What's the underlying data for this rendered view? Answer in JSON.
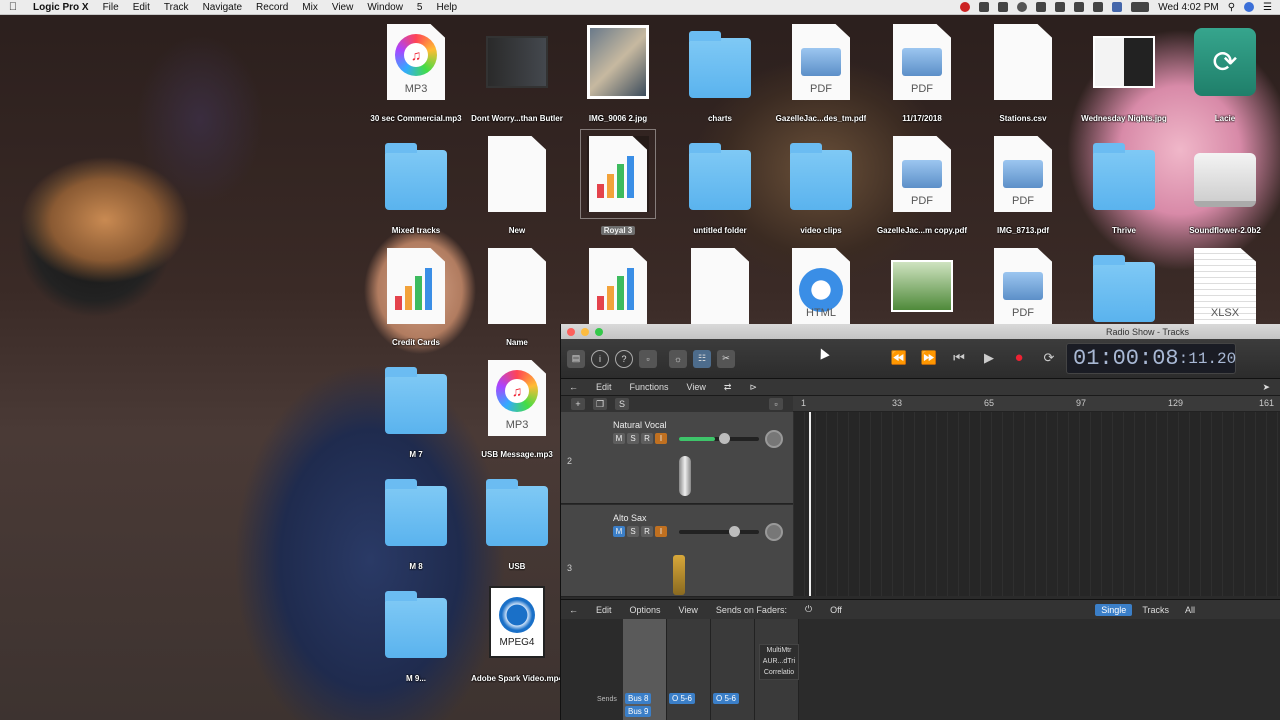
{
  "menubar": {
    "app": "Logic Pro X",
    "items": [
      "File",
      "Edit",
      "Track",
      "Navigate",
      "Record",
      "Mix",
      "View",
      "Window",
      "5",
      "Help"
    ],
    "clock": "Wed 4:02 PM"
  },
  "desktop": {
    "r1": [
      "30 sec Commercial.mp3",
      "Dont Worry...than Butler",
      "IMG_9006 2.jpg",
      "charts",
      "GazelleJac...des_tm.pdf",
      "11/17/2018",
      "Stations.csv",
      "Wednesday Nights.jpg",
      "Lacie"
    ],
    "r2": [
      "Mixed tracks",
      "New",
      "Royal 3",
      "untitled folder",
      "video clips",
      "GazelleJac...m copy.pdf",
      "IMG_8713.pdf",
      "Thrive",
      "Soundflower-2.0b2"
    ],
    "r3": [
      "Credit Cards",
      "Name"
    ],
    "r4": [
      "M 7",
      "USB Message.mp3"
    ],
    "r5": [
      "M 8",
      "USB"
    ],
    "r6": [
      "M 9...",
      "Adobe Spark Video.mp4"
    ],
    "tags": {
      "mp3": "MP3",
      "pdf": "PDF",
      "html": "HTML",
      "xlsx": "XLSX",
      "mpeg": "MPEG4"
    }
  },
  "logic": {
    "title": "Radio Show - Tracks",
    "lcd_main": "01:00:08",
    "lcd_sub": ":11.20",
    "tracks_menu": {
      "edit": "Edit",
      "functions": "Functions",
      "view": "View"
    },
    "ruler": [
      "1",
      "33",
      "65",
      "97",
      "129",
      "161"
    ],
    "tracks": [
      {
        "num": "2",
        "name": "Natural Vocal"
      },
      {
        "num": "3",
        "name": "Alto Sax"
      }
    ],
    "mixer_menu": {
      "edit": "Edit",
      "options": "Options",
      "view": "View",
      "sends": "Sends on Faders:",
      "off": "Off"
    },
    "mixer_modes": [
      "Single",
      "Tracks",
      "All"
    ],
    "plugin_text": "MultiMtr AUR...dTri Correlatio",
    "sends_label": "Sends",
    "sends": [
      "Bus 8",
      "Bus 9",
      "O 5-6",
      "O 5-6"
    ]
  }
}
